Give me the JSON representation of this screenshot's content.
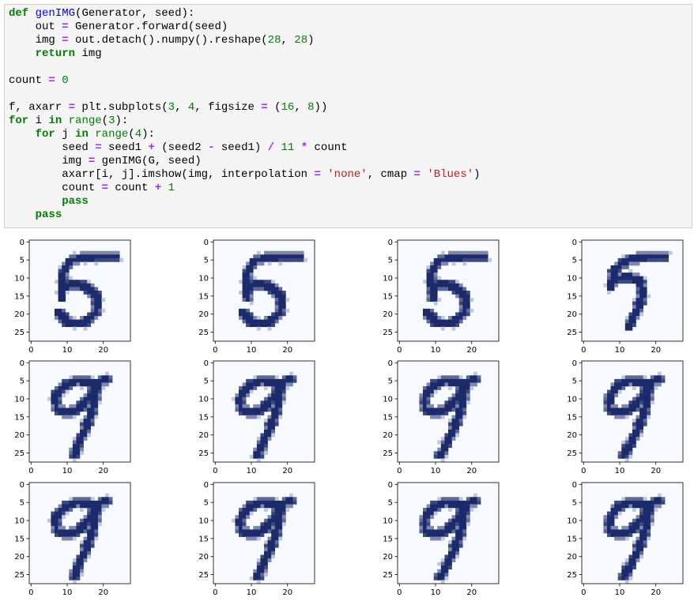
{
  "code": {
    "lines": [
      [
        [
          "kw",
          "def"
        ],
        [
          "t",
          " "
        ],
        [
          "fn",
          "genIMG"
        ],
        [
          "t",
          "(Generator, seed):"
        ]
      ],
      [
        [
          "t",
          "    out "
        ],
        [
          "op",
          "="
        ],
        [
          "t",
          " Generator.forward(seed)"
        ]
      ],
      [
        [
          "t",
          "    img "
        ],
        [
          "op",
          "="
        ],
        [
          "t",
          " out.detach().numpy().reshape("
        ],
        [
          "num",
          "28"
        ],
        [
          "t",
          ", "
        ],
        [
          "num",
          "28"
        ],
        [
          "t",
          ")"
        ]
      ],
      [
        [
          "t",
          "    "
        ],
        [
          "kw",
          "return"
        ],
        [
          "t",
          " img"
        ]
      ],
      [],
      [
        [
          "t",
          "count "
        ],
        [
          "op",
          "="
        ],
        [
          "t",
          " "
        ],
        [
          "num",
          "0"
        ]
      ],
      [],
      [
        [
          "t",
          "f, axarr "
        ],
        [
          "op",
          "="
        ],
        [
          "t",
          " plt.subplots("
        ],
        [
          "num",
          "3"
        ],
        [
          "t",
          ", "
        ],
        [
          "num",
          "4"
        ],
        [
          "t",
          ", figsize "
        ],
        [
          "op",
          "="
        ],
        [
          "t",
          " ("
        ],
        [
          "num",
          "16"
        ],
        [
          "t",
          ", "
        ],
        [
          "num",
          "8"
        ],
        [
          "t",
          "))"
        ]
      ],
      [
        [
          "kw",
          "for"
        ],
        [
          "t",
          " i "
        ],
        [
          "kw",
          "in"
        ],
        [
          "t",
          " "
        ],
        [
          "bi",
          "range"
        ],
        [
          "t",
          "("
        ],
        [
          "num",
          "3"
        ],
        [
          "t",
          "):"
        ]
      ],
      [
        [
          "t",
          "    "
        ],
        [
          "kw",
          "for"
        ],
        [
          "t",
          " j "
        ],
        [
          "kw",
          "in"
        ],
        [
          "t",
          " "
        ],
        [
          "bi",
          "range"
        ],
        [
          "t",
          "("
        ],
        [
          "num",
          "4"
        ],
        [
          "t",
          "):"
        ]
      ],
      [
        [
          "t",
          "        seed "
        ],
        [
          "op",
          "="
        ],
        [
          "t",
          " seed1 "
        ],
        [
          "op",
          "+"
        ],
        [
          "t",
          " (seed2 "
        ],
        [
          "op",
          "-"
        ],
        [
          "t",
          " seed1) "
        ],
        [
          "op",
          "/"
        ],
        [
          "t",
          " "
        ],
        [
          "num",
          "11"
        ],
        [
          "t",
          " "
        ],
        [
          "op",
          "*"
        ],
        [
          "t",
          " count"
        ]
      ],
      [
        [
          "t",
          "        img "
        ],
        [
          "op",
          "="
        ],
        [
          "t",
          " genIMG(G, seed)"
        ]
      ],
      [
        [
          "t",
          "        axarr[i, j].imshow(img, interpolation "
        ],
        [
          "op",
          "="
        ],
        [
          "t",
          " "
        ],
        [
          "str",
          "'none'"
        ],
        [
          "t",
          ", cmap "
        ],
        [
          "op",
          "="
        ],
        [
          "t",
          " "
        ],
        [
          "str",
          "'Blues'"
        ],
        [
          "t",
          ")"
        ]
      ],
      [
        [
          "t",
          "        count "
        ],
        [
          "op",
          "="
        ],
        [
          "t",
          " count "
        ],
        [
          "op",
          "+"
        ],
        [
          "t",
          " "
        ],
        [
          "num",
          "1"
        ]
      ],
      [
        [
          "t",
          "        "
        ],
        [
          "kw",
          "pass"
        ]
      ],
      [
        [
          "t",
          "    "
        ],
        [
          "kw",
          "pass"
        ]
      ]
    ]
  },
  "figure": {
    "rows": 3,
    "cols": 4,
    "image_size": 28,
    "colormap": "Blues",
    "y_tick_labels": [
      "0",
      "5",
      "10",
      "15",
      "20",
      "25"
    ],
    "x_tick_labels": [
      "0",
      "10",
      "20"
    ],
    "colors": {
      "low": "#f7fbff",
      "high": "#1b2a6b",
      "mid": "#6a9fcf",
      "frame": "#000000"
    },
    "panels": [
      {
        "row": 0,
        "col": 0,
        "digit_shown": "5"
      },
      {
        "row": 0,
        "col": 1,
        "digit_shown": "5"
      },
      {
        "row": 0,
        "col": 2,
        "digit_shown": "5"
      },
      {
        "row": 0,
        "col": 3,
        "digit_shown": "7"
      },
      {
        "row": 1,
        "col": 0,
        "digit_shown": "9"
      },
      {
        "row": 1,
        "col": 1,
        "digit_shown": "9"
      },
      {
        "row": 1,
        "col": 2,
        "digit_shown": "9"
      },
      {
        "row": 1,
        "col": 3,
        "digit_shown": "9"
      },
      {
        "row": 2,
        "col": 0,
        "digit_shown": "9"
      },
      {
        "row": 2,
        "col": 1,
        "digit_shown": "9"
      },
      {
        "row": 2,
        "col": 2,
        "digit_shown": "9"
      },
      {
        "row": 2,
        "col": 3,
        "digit_shown": "9"
      }
    ]
  }
}
